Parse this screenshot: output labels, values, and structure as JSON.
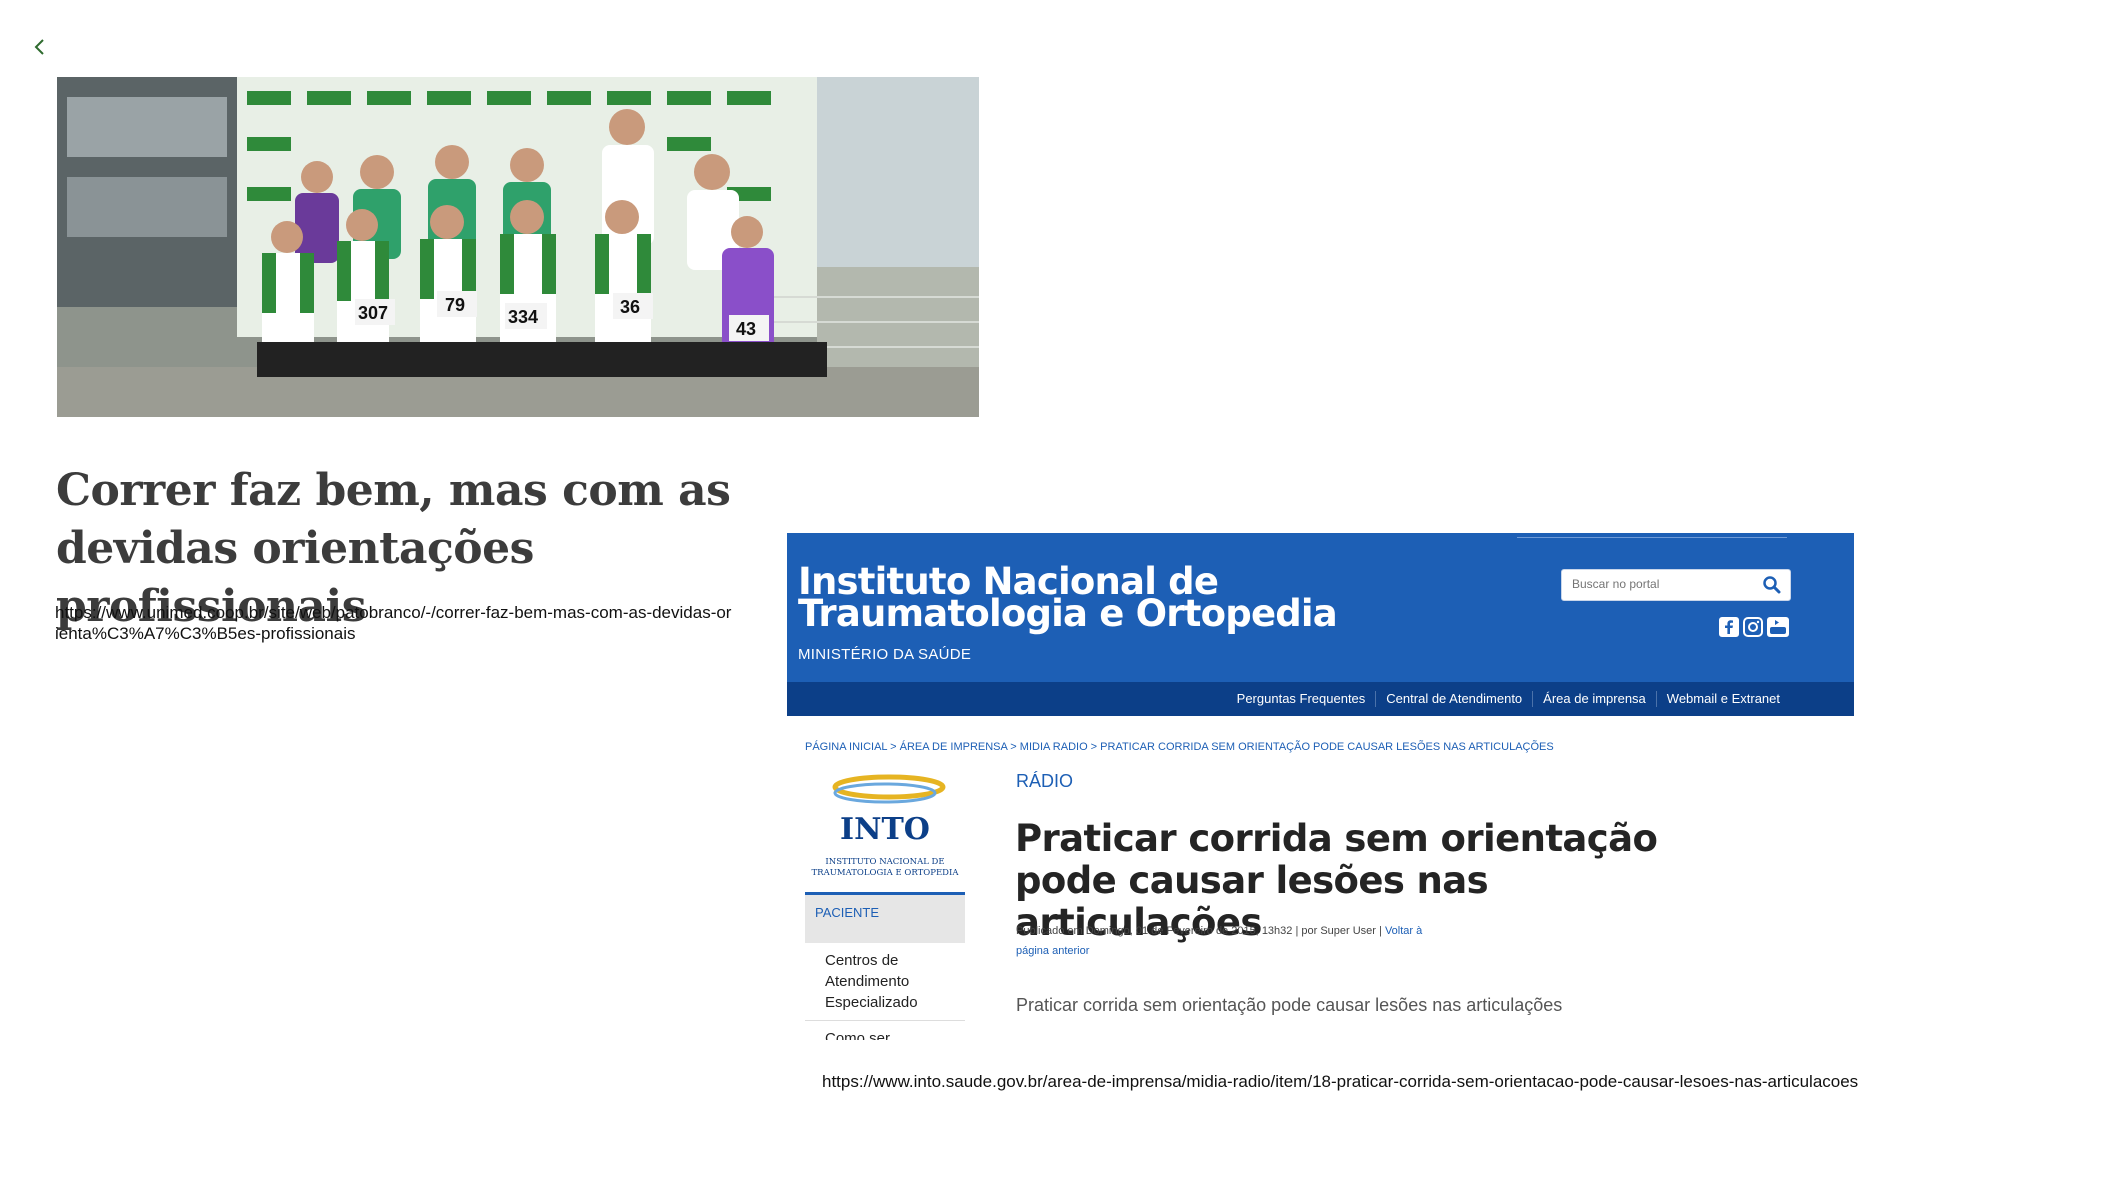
{
  "unimed": {
    "title": "Correr faz bem, mas com as devidas orientações profissionais",
    "url": "https://www.unimed.coop.br/site/web/patobranco/-/correr-faz-bem-mas-com-as-devidas-orienta%C3%A7%C3%B5es-profissionais",
    "photo_bibs": [
      "307",
      "79",
      "334",
      "36",
      "43"
    ]
  },
  "into": {
    "header": {
      "title_line1": "Instituto Nacional de",
      "title_line2": "Traumatologia e Ortopedia",
      "ministry": "MINISTÉRIO DA SAÚDE",
      "search_placeholder": "Buscar no portal"
    },
    "nav": [
      "Perguntas Frequentes",
      "Central de Atendimento",
      "Área de imprensa",
      "Webmail e Extranet"
    ],
    "breadcrumb": "PÁGINA INICIAL > ÁREA DE IMPRENSA > MIDIA RADIO > PRATICAR CORRIDA SEM ORIENTAÇÃO PODE CAUSAR LESÕES NAS ARTICULAÇÕES",
    "logo": {
      "acronym": "INTO",
      "line1": "INSTITUTO NACIONAL DE",
      "line2": "TRAUMATOLOGIA E ORTOPEDIA"
    },
    "sidebar": {
      "section": "PACIENTE",
      "items": [
        "Centros de Atendimento Especializado",
        "Como ser atendido"
      ]
    },
    "category": "RÁDIO",
    "article_title": "Praticar corrida sem orientação pode causar lesões nas articulações",
    "meta_text": "Publicado em Domingo, 01 de Fevereiro de 2015, 13h32 | por Super User | ",
    "meta_link": "Voltar à página anterior",
    "lead": "Praticar corrida sem orientação pode causar lesões nas articulações",
    "url": "https://www.into.saude.gov.br/area-de-imprensa/midia-radio/item/18-praticar-corrida-sem-orientacao-pode-causar-lesoes-nas-articulacoes"
  },
  "colors": {
    "into_blue": "#1d5fb5",
    "into_navy": "#0c3f88",
    "unimed_green": "#2f8a3a"
  }
}
